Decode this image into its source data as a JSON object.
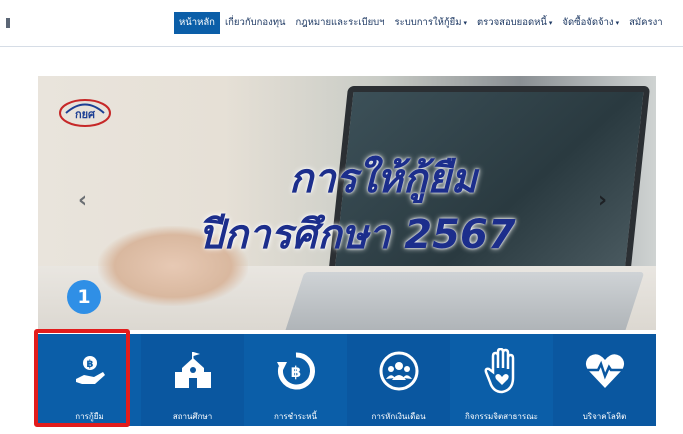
{
  "nav": {
    "items": [
      {
        "label": "หน้าหลัก",
        "active": true,
        "dropdown": false
      },
      {
        "label": "เกี่ยวกับกองทุน",
        "active": false,
        "dropdown": false
      },
      {
        "label": "กฎหมายและระเบียบฯ",
        "active": false,
        "dropdown": false
      },
      {
        "label": "ระบบการให้กู้ยืม",
        "active": false,
        "dropdown": true
      },
      {
        "label": "ตรวจสอบยอดหนี้",
        "active": false,
        "dropdown": true
      },
      {
        "label": "จัดซื้อจัดจ้าง",
        "active": false,
        "dropdown": true
      },
      {
        "label": "สมัครงา",
        "active": false,
        "dropdown": false
      }
    ],
    "caret": "▾"
  },
  "banner": {
    "logo_text": "กยศ",
    "title_line1": "การให้กู้ยืม",
    "title_line2": "ปีการศึกษา 2567",
    "prev_arrow": "‹",
    "next_arrow": "›"
  },
  "step_badge": "1",
  "menu": {
    "tiles": [
      {
        "label": "การกู้ยืม",
        "icon": "hand-coin-icon"
      },
      {
        "label": "สถานศึกษา",
        "icon": "school-icon"
      },
      {
        "label": "การชำระหนี้",
        "icon": "repayment-icon"
      },
      {
        "label": "การหักเงินเดือน",
        "icon": "people-icon"
      },
      {
        "label": "กิจกรรมจิตสาธารณะ",
        "icon": "hand-heart-icon"
      },
      {
        "label": "บริจาคโลหิต",
        "icon": "heart-pulse-icon"
      }
    ]
  },
  "colors": {
    "nav_active": "#0b5ea8",
    "menu_bg": "#0b5ea8",
    "title": "#1c2e8c",
    "badge": "#2f8fe6",
    "highlight": "#e21c1c"
  }
}
